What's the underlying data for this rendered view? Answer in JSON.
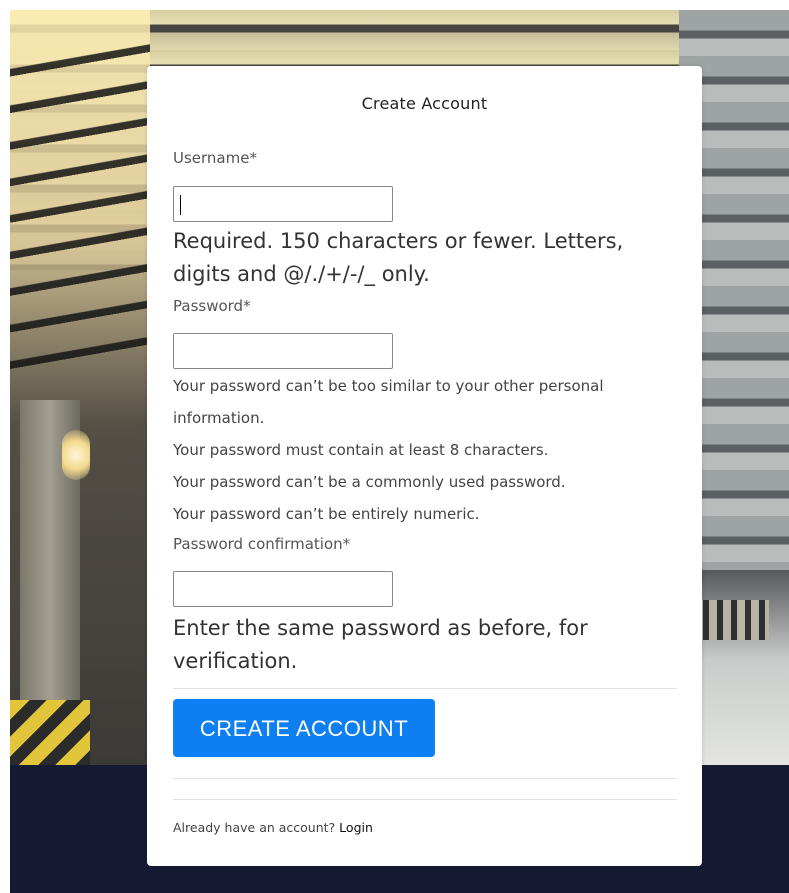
{
  "form": {
    "title": "Create Account",
    "username": {
      "label": "Username*",
      "value": "",
      "help": "Required. 150 characters or fewer. Letters, digits and @/./+/-/_ only."
    },
    "password": {
      "label": "Password*",
      "value": "",
      "help": [
        "Your password can’t be too similar to your other personal information.",
        "Your password must contain at least 8 characters.",
        "Your password can’t be a commonly used password.",
        "Your password can’t be entirely numeric."
      ]
    },
    "password_confirmation": {
      "label": "Password confirmation*",
      "value": "",
      "help": "Enter the same password as before, for verification."
    },
    "submit_label": "CREATE ACCOUNT",
    "footer": {
      "prompt": "Already have an account?",
      "login_label": "Login"
    }
  },
  "colors": {
    "primary_button": "#0d7ff2",
    "dark_band": "#151a33",
    "card_background": "#ffffff"
  }
}
